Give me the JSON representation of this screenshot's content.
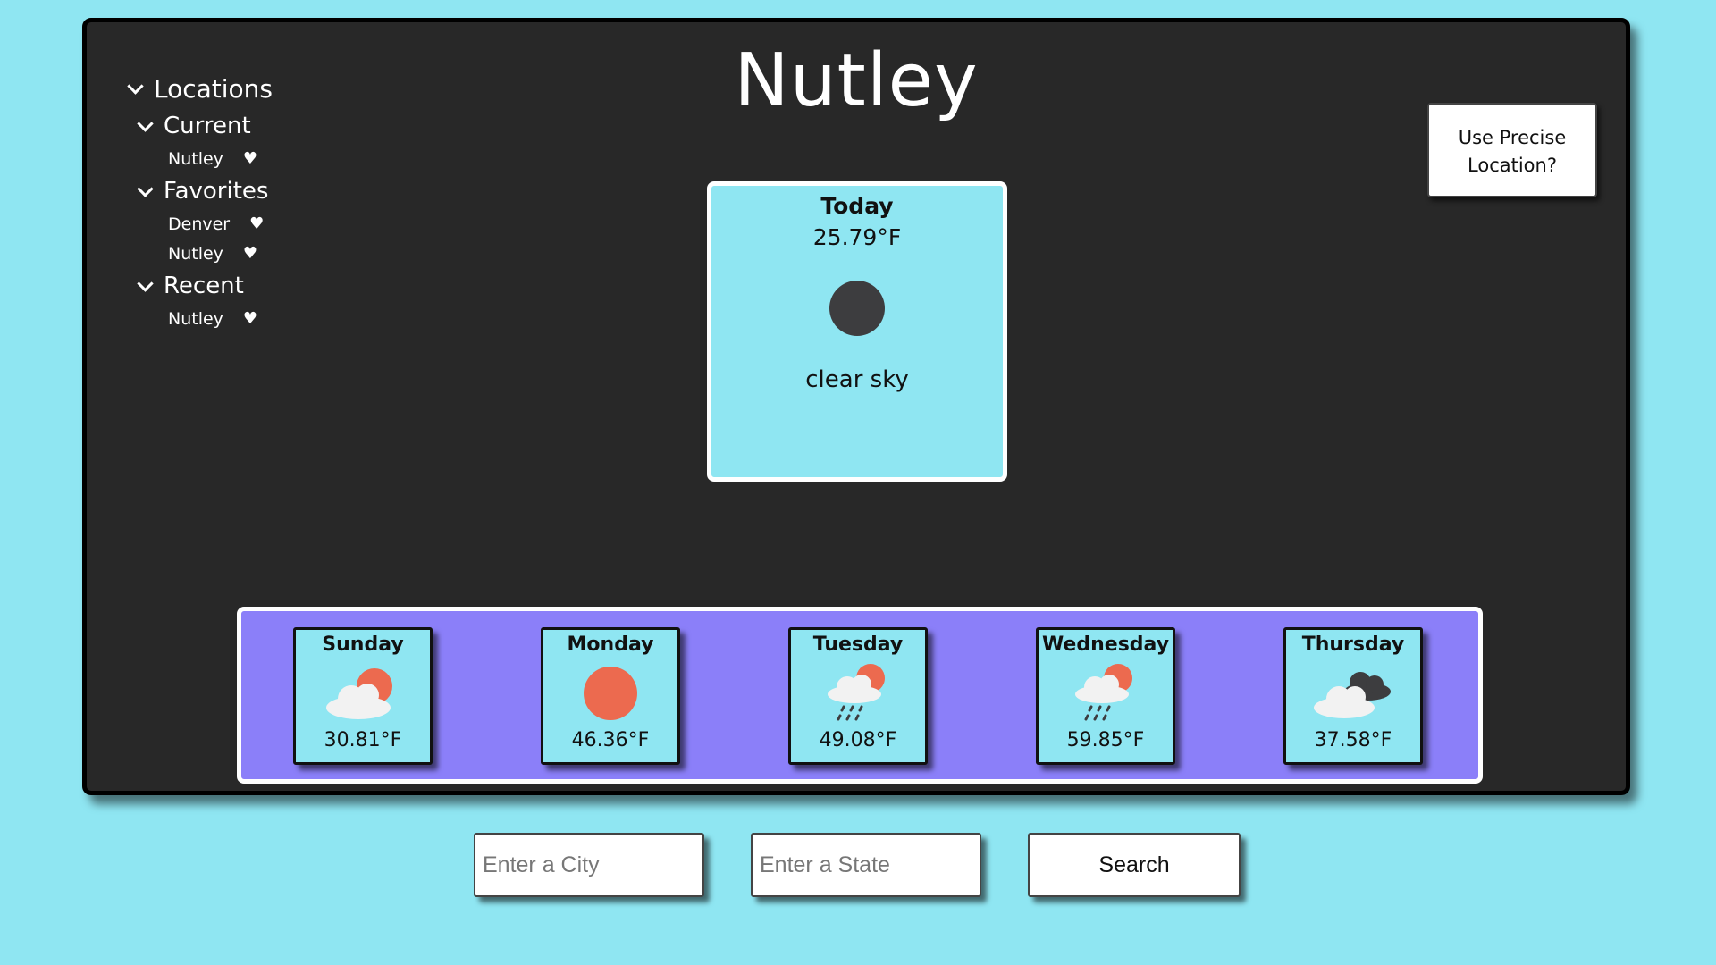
{
  "city_title": "Nutley",
  "sidebar": {
    "root_label": "Locations",
    "groups": [
      {
        "label": "Current",
        "items": [
          {
            "name": "Nutley",
            "heart": "♥"
          }
        ]
      },
      {
        "label": "Favorites",
        "items": [
          {
            "name": "Denver",
            "heart": "♥"
          },
          {
            "name": "Nutley",
            "heart": "♥"
          }
        ]
      },
      {
        "label": "Recent",
        "items": [
          {
            "name": "Nutley",
            "heart": "♥"
          }
        ]
      }
    ]
  },
  "today": {
    "day": "Today",
    "temp": "25.79°F",
    "icon": "moon-icon",
    "description": "clear sky"
  },
  "precise_location_label": "Use Precise Location?",
  "forecast": [
    {
      "day": "Sunday",
      "temp": "30.81°F",
      "icon": "partly-cloudy-icon"
    },
    {
      "day": "Monday",
      "temp": "46.36°F",
      "icon": "sun-icon"
    },
    {
      "day": "Tuesday",
      "temp": "49.08°F",
      "icon": "rain-sun-icon"
    },
    {
      "day": "Wednesday",
      "temp": "59.85°F",
      "icon": "rain-sun-icon"
    },
    {
      "day": "Thursday",
      "temp": "37.58°F",
      "icon": "cloudy-icon"
    }
  ],
  "search": {
    "city_placeholder": "Enter a City",
    "state_placeholder": "Enter a State",
    "button_label": "Search"
  },
  "colors": {
    "background": "#8fe6f2",
    "panel": "#282828",
    "forecast_strip": "#8b7ff9",
    "sun": "#ec6a4f",
    "dark_cloud": "#3d3d3f"
  }
}
